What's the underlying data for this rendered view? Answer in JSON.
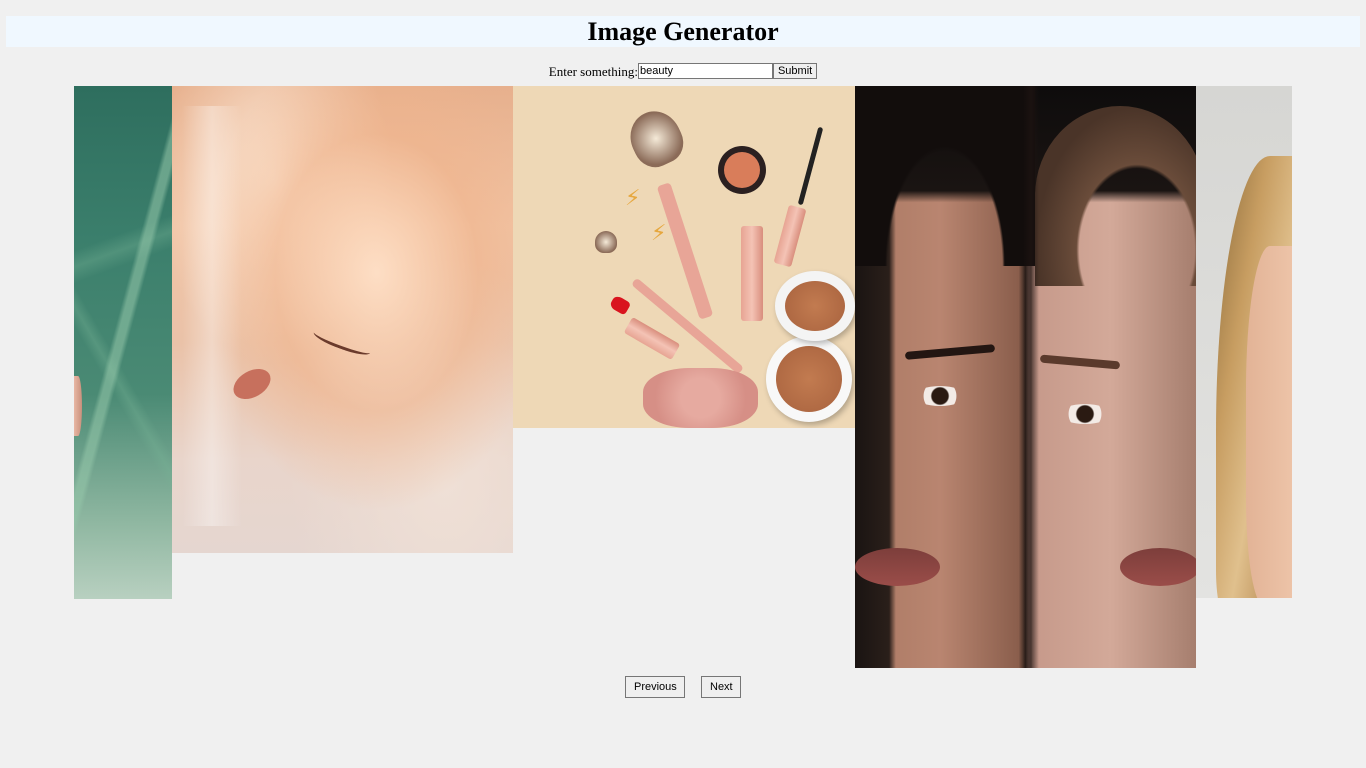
{
  "header": {
    "title": "Image Generator"
  },
  "search_form": {
    "label": "Enter something:",
    "input_value": "beauty",
    "submit_label": "Submit"
  },
  "gallery": {
    "images": [
      {
        "subject": "monstera leaf with face edge"
      },
      {
        "subject": "woman with closed eyes in warm light"
      },
      {
        "subject": "makeup products flat lay"
      },
      {
        "subject": "two women faces side by side"
      },
      {
        "subject": "blonde woman profile"
      }
    ]
  },
  "pagination": {
    "previous_label": "Previous",
    "next_label": "Next"
  }
}
